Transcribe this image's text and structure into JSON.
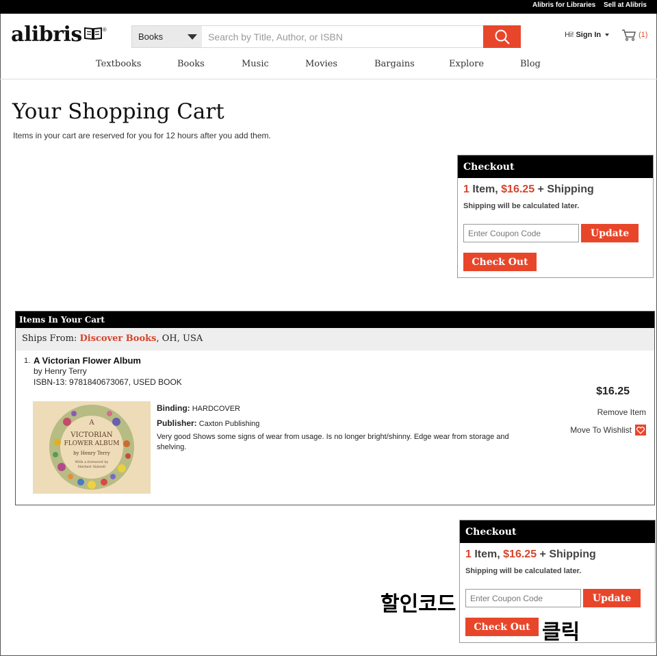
{
  "top_links": {
    "libraries": "Alibris for Libraries",
    "sell": "Sell at Alibris"
  },
  "header": {
    "logo": "alibris",
    "search": {
      "category": "Books",
      "placeholder": "Search by Title, Author, or ISBN"
    },
    "signin": {
      "hi": "Hi!",
      "label": "Sign In"
    },
    "cart_count": "(1)"
  },
  "nav": [
    "Textbooks",
    "Books",
    "Music",
    "Movies",
    "Bargains",
    "Explore",
    "Blog"
  ],
  "page": {
    "title": "Your Shopping Cart",
    "subtitle": "Items in your cart are reserved for you for 12 hours after you add them."
  },
  "checkout": {
    "heading": "Checkout",
    "count": "1",
    "item_word": "Item,",
    "total": "$16.25",
    "shipping_suffix": "+ Shipping",
    "shipping_note": "Shipping will be calculated later.",
    "coupon_placeholder": "Enter Coupon Code",
    "update_label": "Update",
    "checkout_label": "Check Out"
  },
  "items_section": {
    "heading": "Items In Your Cart",
    "ships_from_label": "Ships From:",
    "seller": "Discover Books",
    "seller_location": ", OH, USA",
    "item": {
      "number": "1.",
      "title": "A Victorian Flower Album",
      "author": "by Henry Terry",
      "isbn": "ISBN-13: 9781840673067, USED BOOK",
      "binding_label": "Binding:",
      "binding": "HARDCOVER",
      "publisher_label": "Publisher:",
      "publisher": "Caxton Publishing",
      "condition": "Very good Shows some signs of wear from usage. Is no longer bright/shinny. Edge wear from storage and shelving.",
      "price": "$16.25",
      "remove_label": "Remove Item",
      "wishlist_label": "Move To Wishlist",
      "cover_text": {
        "letter": "A",
        "line1": "VICTORIAN",
        "line2": "FLOWER ALBUM",
        "author": "by Henry Terry",
        "foreword1": "With a foreword by",
        "foreword2": "Herbert Sidwell"
      }
    }
  },
  "annotations": {
    "coupon_hint": "할인코드",
    "click_hint": "클릭"
  },
  "colors": {
    "accent": "#e8462b",
    "price_red": "#d6442c",
    "header_black": "#000000"
  }
}
